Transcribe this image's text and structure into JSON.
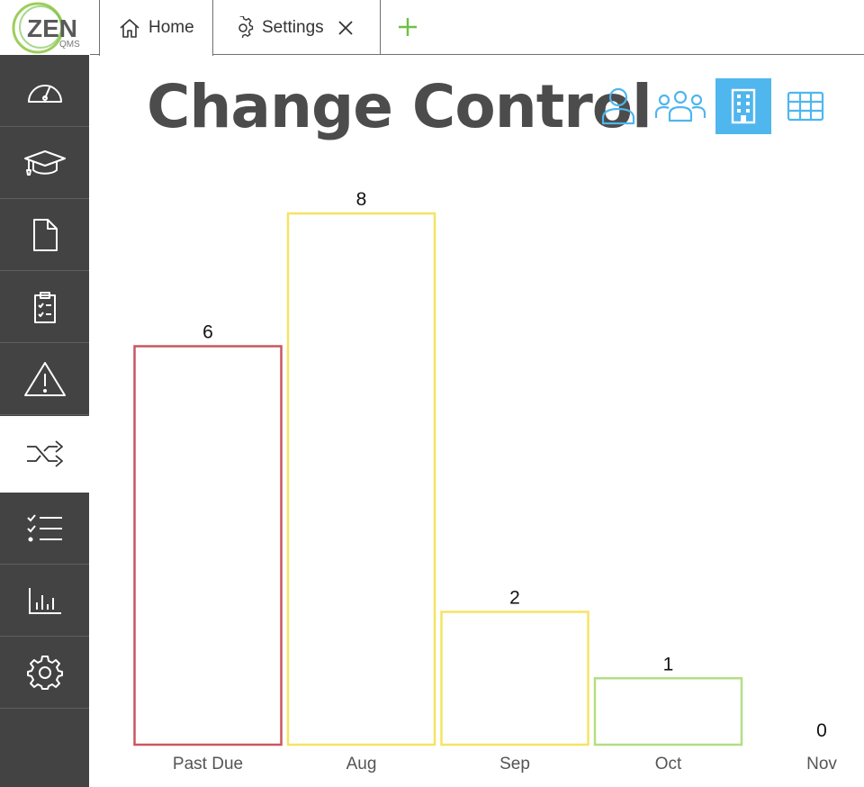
{
  "logo": {
    "brand": "ZEN",
    "sub": "QMS"
  },
  "tabs": [
    {
      "label": "Home",
      "icon": "home-icon"
    },
    {
      "label": "Settings",
      "icon": "gear-icon"
    }
  ],
  "sidebar": {
    "items": [
      {
        "name": "dashboard",
        "icon": "speedometer-icon"
      },
      {
        "name": "training",
        "icon": "graduation-cap-icon"
      },
      {
        "name": "documents",
        "icon": "document-icon"
      },
      {
        "name": "audits",
        "icon": "clipboard-checklist-icon"
      },
      {
        "name": "risk",
        "icon": "warning-icon"
      },
      {
        "name": "change-control",
        "icon": "shuffle-icon",
        "active": true
      },
      {
        "name": "tasks",
        "icon": "checklist-icon"
      },
      {
        "name": "reports",
        "icon": "bar-chart-icon"
      },
      {
        "name": "settings",
        "icon": "gear-icon"
      }
    ]
  },
  "page": {
    "title": "Change Control"
  },
  "view_toggle": [
    {
      "name": "user",
      "icon": "user-icon"
    },
    {
      "name": "group",
      "icon": "users-icon"
    },
    {
      "name": "company",
      "icon": "building-icon",
      "active": true
    },
    {
      "name": "table",
      "icon": "table-icon"
    }
  ],
  "colors": {
    "accent": "#4fb6ee",
    "sidebar": "#434343",
    "add": "#6fbf44"
  },
  "chart_data": {
    "type": "bar",
    "categories": [
      "Past Due",
      "Aug",
      "Sep",
      "Oct",
      "Nov"
    ],
    "values": [
      6,
      8,
      2,
      1,
      0
    ],
    "bar_colors": [
      "#c9575f",
      "#f5e462",
      "#f5e462",
      "#b2df84",
      "#b2df84"
    ],
    "title": "",
    "xlabel": "",
    "ylabel": "",
    "ylim": [
      0,
      8
    ],
    "grid": false,
    "legend": "none"
  }
}
